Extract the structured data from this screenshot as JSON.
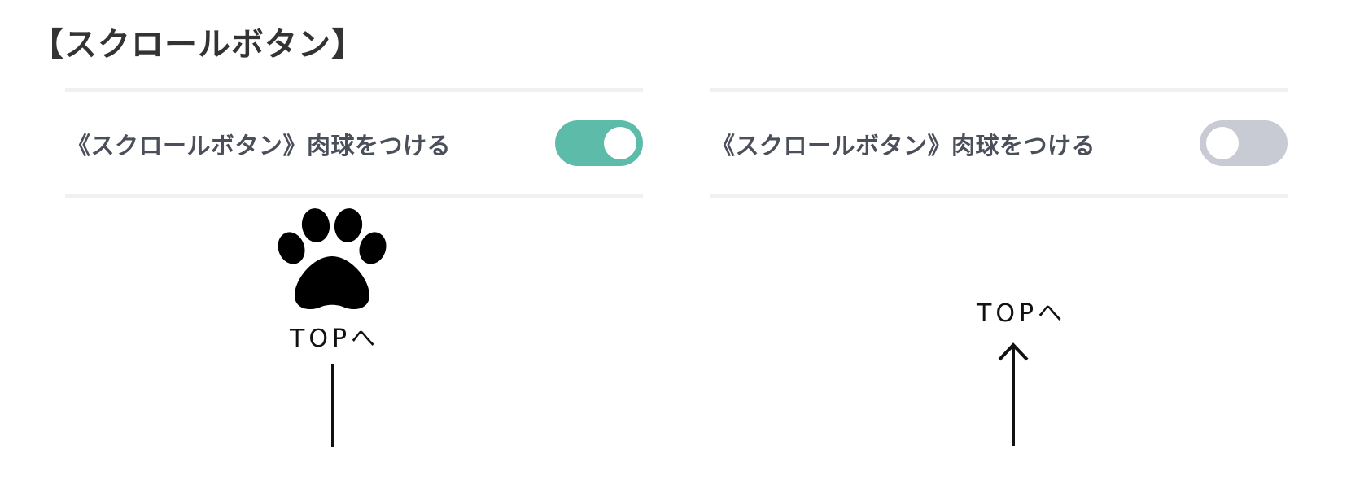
{
  "page": {
    "title": "【スクロールボタン】"
  },
  "settings": [
    {
      "label": "《スクロールボタン》肉球をつける",
      "toggle_state": "on",
      "toggle_color": "#5dbba9"
    },
    {
      "label": "《スクロールボタン》肉球をつける",
      "toggle_state": "off",
      "toggle_color": "#c8cad4"
    }
  ],
  "previews": {
    "paw": {
      "icon": "paw-icon",
      "label": "TOPへ"
    },
    "plain": {
      "icon": "arrow-up-icon",
      "label": "TOPへ"
    }
  }
}
